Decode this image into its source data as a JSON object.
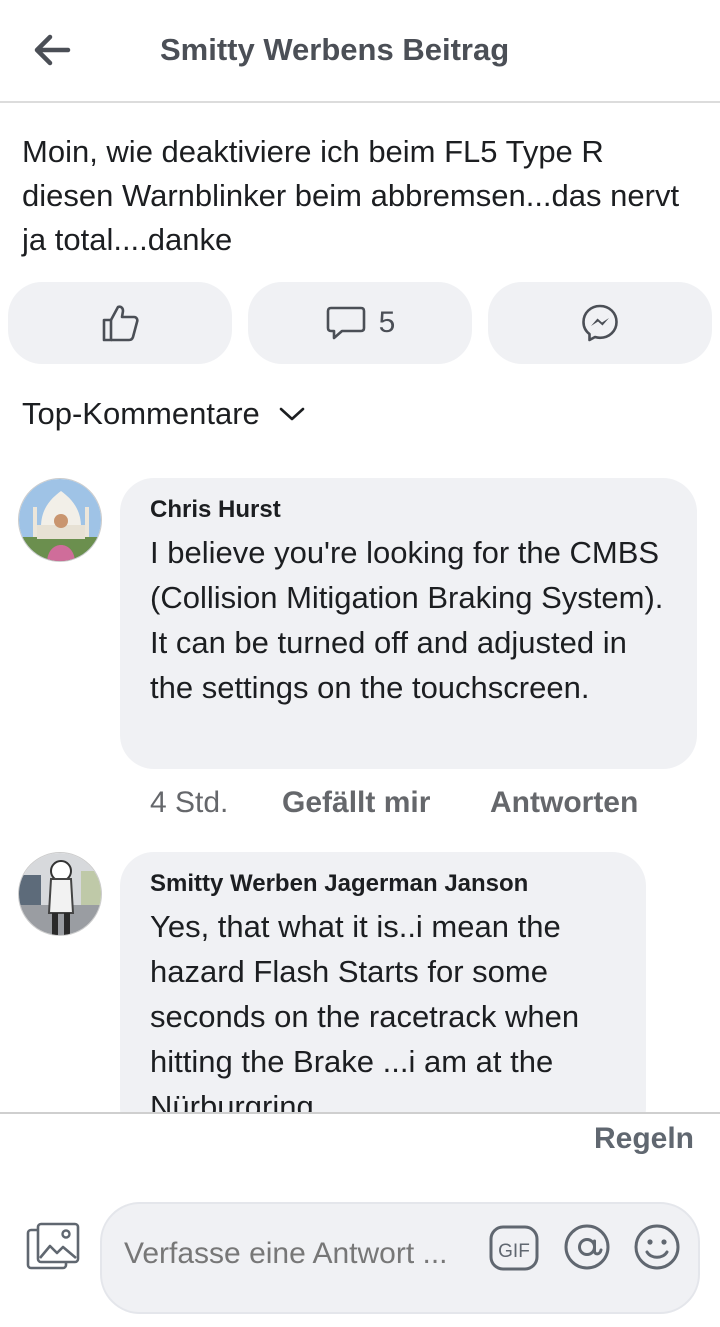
{
  "header": {
    "title": "Smitty Werbens Beitrag",
    "back_icon": "arrow-left-icon"
  },
  "post": {
    "text": "Moin,  wie deaktiviere ich beim FL5 Type R diesen Warnblinker beim abbremsen...das nervt ja total....danke",
    "actions": {
      "like_icon": "thumbs-up-icon",
      "comment_icon": "comment-icon",
      "comment_count": "5",
      "share_icon": "messenger-icon"
    }
  },
  "sort": {
    "label": "Top-Kommentare",
    "icon": "chevron-down-icon"
  },
  "comments": [
    {
      "author": "Chris Hurst",
      "text": "I believe you're looking for the CMBS (Collision Mitigation Braking System). It can be turned off and adjusted in the settings on the touchscreen.",
      "time": "4 Std.",
      "like_label": "Gefällt mir",
      "reply_label": "Antworten"
    },
    {
      "author": "Smitty Werben Jagerman Janson",
      "text": "Yes, that what it is..i mean the hazard Flash Starts for some seconds on the racetrack when hitting the Brake ...i am at the Nürburgring..."
    }
  ],
  "footer": {
    "rules_label": "Regeln",
    "composer_placeholder": "Verfasse eine Antwort ...",
    "icons": [
      "photo-icon",
      "gif-icon",
      "at-sign-icon",
      "smiley-icon"
    ]
  },
  "colors": {
    "text_primary": "#1c1e21",
    "text_secondary": "#65676b",
    "surface": "#f0f1f4",
    "icon": "#4b4f56"
  }
}
